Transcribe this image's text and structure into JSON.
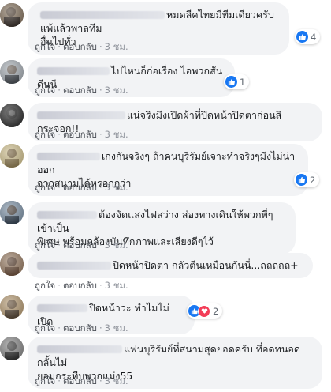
{
  "actions": {
    "like": "ถูกใจ",
    "reply": "ตอบกลับ",
    "time": "3 ชม."
  },
  "comments": [
    {
      "text_line1": "หมดลีคไทยมีทีมเดียวครับแพ้แล้วพาลทีม",
      "text_line2": "อื่นไปทั่ว",
      "reaction_count": "4",
      "reactions": [
        "like-icon"
      ]
    },
    {
      "text_line1": "ไปไหนก็ก่อเรื่อง ไอพวกสันดีนนี",
      "reaction_count": "1",
      "reactions": [
        "like-icon"
      ]
    },
    {
      "text_line1": "แน่จริงมึงเปิดผ้าที่ปิดหน้าปิดตาก่อนสิ กระจอก!!"
    },
    {
      "text_line1": "เก่งกันจริงๆ ถ้าคนบุรีรัมย์เจาะทำจริงๆมึงไม่น่าออก",
      "text_line2": "จากสนามได้หรอกกูว่า",
      "reaction_count": "2",
      "reactions": [
        "like-icon"
      ]
    },
    {
      "text_line1": "ต้องจัดแสงไฟสว่าง ส่องทางเดินให้พวกพี่ๆเข้าเป็น",
      "text_line2": "พิเศษ พร้อมกล้องบันทึกภาพและเสียงดีๆไว้"
    },
    {
      "text_line1": "ปิดหน้าปิดตา กลัวตีนเหมือนกันนี่...ถถถถถ+"
    },
    {
      "text_line1": "ปิดหน้าวะ ทำไมไม่เปิด",
      "reaction_count": "2",
      "reactions": [
        "like-icon",
        "love-icon"
      ]
    },
    {
      "text_line1": "แฟนบุรีรัมย์ที่สนามสุดยอดครับ ที่อดทนอดกลั้นไม่",
      "text_line2": "ยอมกระทืบพวกแม่ง55"
    }
  ],
  "colors": {
    "like": "#1877f2",
    "love": "#f33e58",
    "bubble": "#f2f3f5",
    "link": "#4b4f56"
  }
}
